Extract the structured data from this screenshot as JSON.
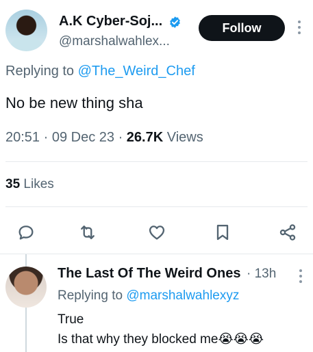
{
  "tweet": {
    "author_name": "A.K Cyber-Soj...",
    "author_handle": "@marshalwahlex...",
    "follow_label": "Follow",
    "replying_prefix": "Replying to",
    "replying_to": "@The_Weird_Chef",
    "text": "No be new thing sha",
    "time": "20:51",
    "date": "09 Dec 23",
    "views_count": "26.7K",
    "views_label": "Views",
    "likes_count": "35",
    "likes_label": "Likes",
    "verified_icon": "verified-badge-icon",
    "accent_color": "#1d9bf0"
  },
  "actions": [
    "reply-icon",
    "retweet-icon",
    "like-icon",
    "bookmark-icon",
    "share-icon"
  ],
  "reply": {
    "author_name": "The Last Of The Weird Ones",
    "time": "13h",
    "replying_prefix": "Replying to",
    "replying_to": "@marshalwahlexyz",
    "line1": "True",
    "line2": "Is that why they blocked me",
    "emoji": "😭😭😭"
  }
}
